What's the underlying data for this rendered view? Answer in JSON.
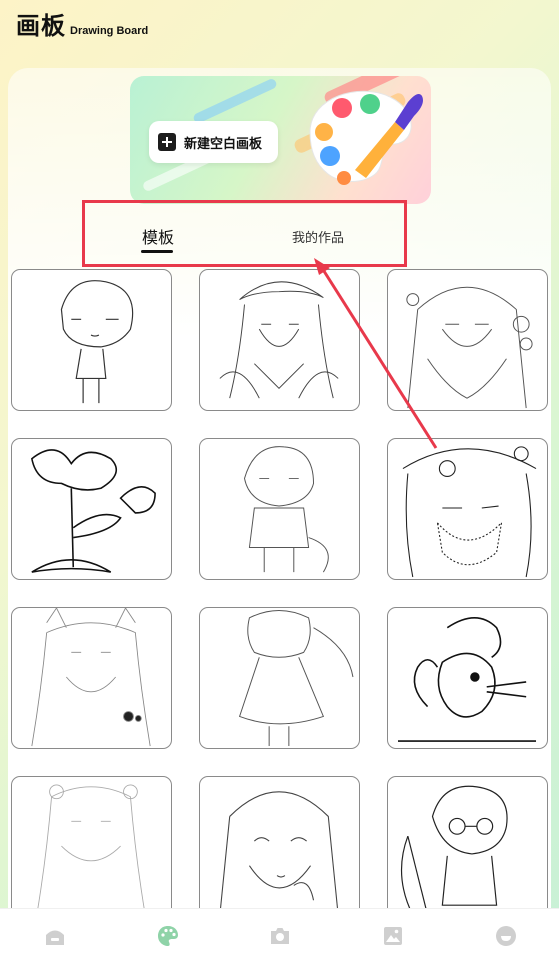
{
  "header": {
    "title_cn": "画板",
    "title_en": "Drawing Board"
  },
  "banner": {
    "new_board_label": "新建空白画板"
  },
  "tabs": [
    {
      "label": "模板",
      "active": true
    },
    {
      "label": "我的作品",
      "active": false
    }
  ],
  "templates": [
    {
      "name": "chibi-boy"
    },
    {
      "name": "girl-bonnet"
    },
    {
      "name": "girl-flowers"
    },
    {
      "name": "flower"
    },
    {
      "name": "chibi-girl-cat"
    },
    {
      "name": "girl-mask"
    },
    {
      "name": "fox-girl"
    },
    {
      "name": "girl-dress"
    },
    {
      "name": "squirrel"
    },
    {
      "name": "girl-ribbons"
    },
    {
      "name": "girl-portrait"
    },
    {
      "name": "boy-glasses-bow"
    }
  ],
  "bottom_nav": [
    {
      "icon": "home-icon"
    },
    {
      "icon": "palette-icon",
      "active": true
    },
    {
      "icon": "camera-icon"
    },
    {
      "icon": "gallery-icon"
    },
    {
      "icon": "profile-icon"
    }
  ],
  "colors": {
    "annotation_red": "#e8394b",
    "active_nav": "#8fd3a8"
  }
}
